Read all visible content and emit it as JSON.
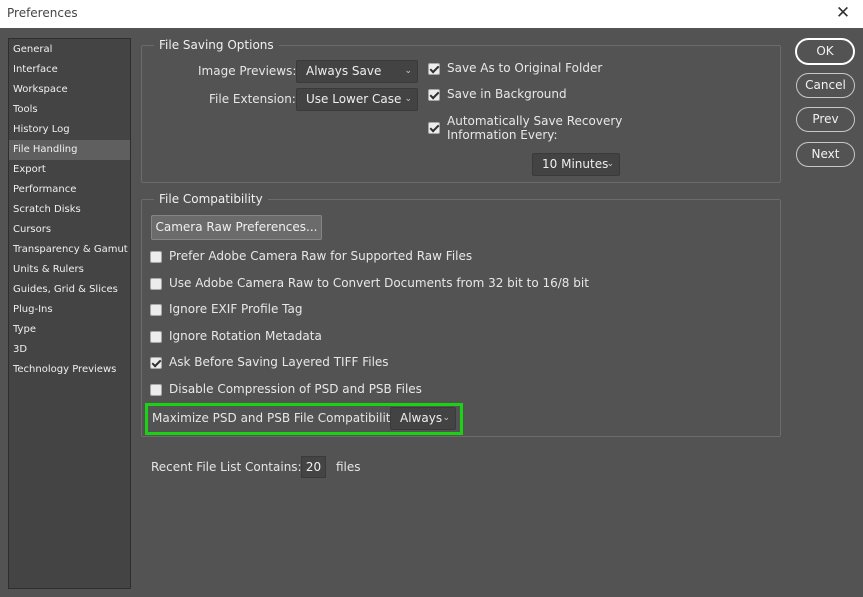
{
  "window": {
    "title": "Preferences",
    "close_glyph": "✕"
  },
  "sidebar": {
    "items": [
      {
        "label": "General"
      },
      {
        "label": "Interface"
      },
      {
        "label": "Workspace"
      },
      {
        "label": "Tools"
      },
      {
        "label": "History Log"
      },
      {
        "label": "File Handling",
        "selected": true
      },
      {
        "label": "Export"
      },
      {
        "label": "Performance"
      },
      {
        "label": "Scratch Disks"
      },
      {
        "label": "Cursors"
      },
      {
        "label": "Transparency & Gamut"
      },
      {
        "label": "Units & Rulers"
      },
      {
        "label": "Guides, Grid & Slices"
      },
      {
        "label": "Plug-Ins"
      },
      {
        "label": "Type"
      },
      {
        "label": "3D"
      },
      {
        "label": "Technology Previews"
      }
    ]
  },
  "file_saving": {
    "legend": "File Saving Options",
    "image_previews_label": "Image Previews:",
    "image_previews_value": "Always Save",
    "file_extension_label": "File Extension:",
    "file_extension_value": "Use Lower Case",
    "save_as_original": {
      "label": "Save As to Original Folder",
      "checked": true
    },
    "save_in_background": {
      "label": "Save in Background",
      "checked": true
    },
    "auto_save": {
      "label_line1": "Automatically Save Recovery",
      "label_line2": "Information Every:",
      "checked": true
    },
    "auto_save_interval": "10 Minutes"
  },
  "file_compat": {
    "legend": "File Compatibility",
    "camera_raw_button": "Camera Raw Preferences...",
    "options": [
      {
        "label": "Prefer Adobe Camera Raw for Supported Raw Files",
        "checked": false
      },
      {
        "label": "Use Adobe Camera Raw to Convert Documents from 32 bit to 16/8 bit",
        "checked": false
      },
      {
        "label": "Ignore EXIF Profile Tag",
        "checked": false
      },
      {
        "label": "Ignore Rotation Metadata",
        "checked": false
      },
      {
        "label": "Ask Before Saving Layered TIFF Files",
        "checked": true
      },
      {
        "label": "Disable Compression of PSD and PSB Files",
        "checked": false
      }
    ],
    "maximize_label": "Maximize PSD and PSB File Compatibility:",
    "maximize_value": "Always",
    "highlight_color": "#1bd114"
  },
  "recent_files": {
    "label": "Recent File List Contains:",
    "value": "20",
    "suffix": "files"
  },
  "buttons": {
    "ok": "OK",
    "cancel": "Cancel",
    "prev": "Prev",
    "next": "Next"
  },
  "icons": {
    "chevron": "⌄"
  }
}
